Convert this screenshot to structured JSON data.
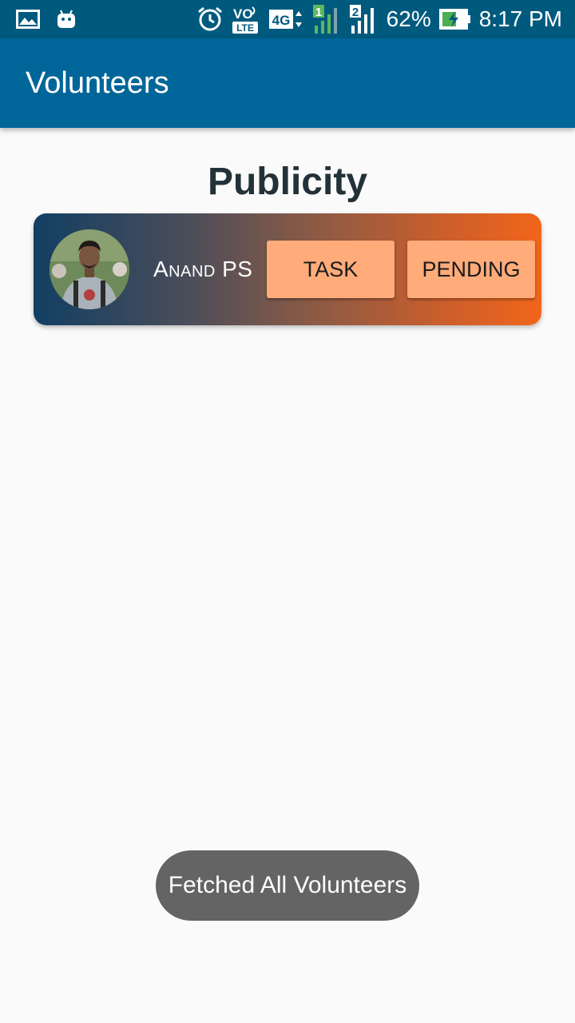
{
  "status_bar": {
    "battery_percent": "62%",
    "time": "8:17 PM",
    "volte_label_top": "VO",
    "volte_label_bottom": "LTE",
    "network_type": "4G",
    "sim1_label": "1",
    "sim2_label": "2",
    "icons": [
      "gallery-icon",
      "android-icon",
      "alarm-icon",
      "volte-icon",
      "4g-icon",
      "signal-sim1-icon",
      "signal-sim2-icon",
      "battery-charging-icon"
    ]
  },
  "app_bar": {
    "title": "Volunteers"
  },
  "section": {
    "title": "Publicity"
  },
  "volunteers": [
    {
      "name": "Anand PS",
      "task_label": "TASK",
      "status_label": "PENDING"
    }
  ],
  "toast": {
    "message": "Fetched All Volunteers"
  },
  "colors": {
    "status_bar": "#005a7e",
    "app_bar": "#006699",
    "background": "#fafafa",
    "card_gradient_start": "#123f63",
    "card_gradient_end": "#f2651a",
    "button_fill": "#ffab7a",
    "toast": "#646464"
  }
}
